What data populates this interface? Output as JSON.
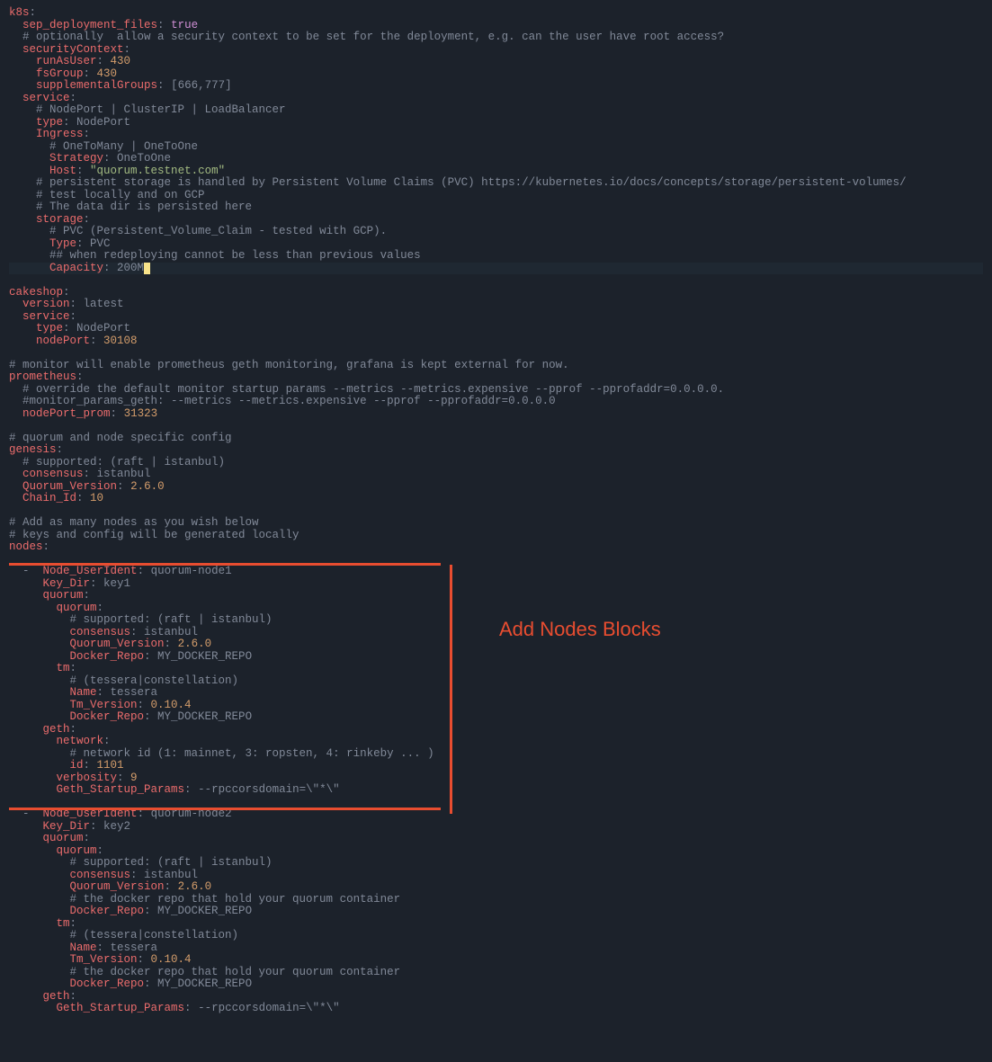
{
  "annotation_label": "Add Nodes Blocks",
  "yaml": {
    "k8s": {
      "sep_deployment_files": "true",
      "comment_security": "# optionally  allow a security context to be set for the deployment, e.g. can the user have root access?",
      "securityContext": {
        "runAsUser": "430",
        "fsGroup": "430",
        "supplementalGroups": "[666,777]"
      },
      "service": {
        "comment_nodeport": "# NodePort | ClusterIP | LoadBalancer",
        "type": "NodePort",
        "Ingress": {
          "comment_onetomany": "# OneToMany | OneToOne",
          "Strategy": "OneToOne",
          "Host": "\"quorum.testnet.com\""
        },
        "comment_persistent": "# persistent storage is handled by Persistent Volume Claims (PVC) https://kubernetes.io/docs/concepts/storage/persistent-volumes/",
        "comment_test_locally": "# test locally and on GCP",
        "comment_data_dir": "# The data dir is persisted here",
        "storage": {
          "comment_pvc": "# PVC (Persistent_Volume_Claim - tested with GCP).",
          "Type": "PVC",
          "comment_redeploy": "## when redeploying cannot be less than previous values",
          "Capacity": "200M"
        }
      }
    },
    "cakeshop": {
      "version": "latest",
      "service": {
        "type": "NodePort",
        "nodePort": "30108"
      }
    },
    "comment_monitor": "# monitor will enable prometheus geth monitoring, grafana is kept external for now.",
    "prometheus": {
      "comment_override": "# override the default monitor startup params --metrics --metrics.expensive --pprof --pprofaddr=0.0.0.0.",
      "comment_monitor_params": "#monitor_params_geth: --metrics --metrics.expensive --pprof --pprofaddr=0.0.0.0",
      "nodePort_prom": "31323"
    },
    "comment_quorum": "# quorum and node specific config",
    "genesis": {
      "comment_supported": "# supported: (raft | istanbul)",
      "consensus": "istanbul",
      "Quorum_Version": "2.6.0",
      "Chain_Id": "10"
    },
    "comment_add_nodes": "# Add as many nodes as you wish below",
    "comment_keys": "# keys and config will be generated locally",
    "nodes": {
      "n1": {
        "Node_UserIdent": "quorum-node1",
        "Key_Dir": "key1",
        "quorum": {
          "quorum": {
            "comment_supported": "# supported: (raft | istanbul)",
            "consensus": "istanbul",
            "Quorum_Version": "2.6.0",
            "Docker_Repo": "MY_DOCKER_REPO"
          },
          "tm": {
            "comment_tessera": "# (tessera|constellation)",
            "Name": "tessera",
            "Tm_Version": "0.10.4",
            "Docker_Repo": "MY_DOCKER_REPO"
          }
        },
        "geth": {
          "network": {
            "comment_network": "# network id (1: mainnet, 3: ropsten, 4: rinkeby ... )",
            "id": "1101"
          },
          "verbosity": "9",
          "Geth_Startup_Params": "--rpccorsdomain=\\\"*\\\""
        }
      },
      "n2": {
        "Node_UserIdent": "quorum-node2",
        "Key_Dir": "key2",
        "quorum": {
          "quorum": {
            "comment_supported": "# supported: (raft | istanbul)",
            "consensus": "istanbul",
            "Quorum_Version": "2.6.0",
            "comment_docker": "# the docker repo that hold your quorum container",
            "Docker_Repo": "MY_DOCKER_REPO"
          },
          "tm": {
            "comment_tessera": "# (tessera|constellation)",
            "Name": "tessera",
            "Tm_Version": "0.10.4",
            "comment_docker": "# the docker repo that hold your quorum container",
            "Docker_Repo": "MY_DOCKER_REPO"
          }
        },
        "geth": {
          "Geth_Startup_Params": "--rpccorsdomain=\\\"*\\\""
        }
      }
    }
  }
}
